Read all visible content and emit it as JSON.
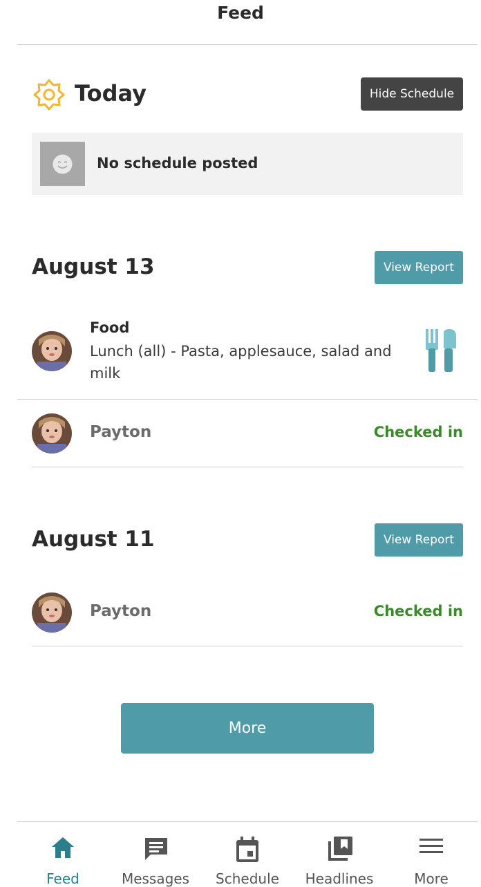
{
  "header": {
    "title": "Feed"
  },
  "today": {
    "title": "Today",
    "hide_schedule_label": "Hide Schedule",
    "no_schedule_text": "No schedule posted"
  },
  "sections": [
    {
      "date": "August 13",
      "view_report_label": "View Report",
      "food": {
        "title": "Food",
        "description": "Lunch (all) - Pasta, applesauce, salad and milk"
      },
      "checkin": {
        "name": "Payton",
        "status": "Checked in"
      }
    },
    {
      "date": "August 11",
      "view_report_label": "View Report",
      "checkin": {
        "name": "Payton",
        "status": "Checked in"
      }
    }
  ],
  "more_button": "More",
  "nav": [
    {
      "label": "Feed",
      "icon": "home-icon",
      "active": true
    },
    {
      "label": "Messages",
      "icon": "message-icon"
    },
    {
      "label": "Schedule",
      "icon": "calendar-icon"
    },
    {
      "label": "Headlines",
      "icon": "bookmark-stack-icon"
    },
    {
      "label": "More",
      "icon": "menu-icon"
    }
  ],
  "colors": {
    "accent": "#4f9ca8",
    "nav_active": "#2b7e8c",
    "checked_in": "#3a8a2a",
    "sun": "#f2b632",
    "dark_button": "#444444"
  }
}
